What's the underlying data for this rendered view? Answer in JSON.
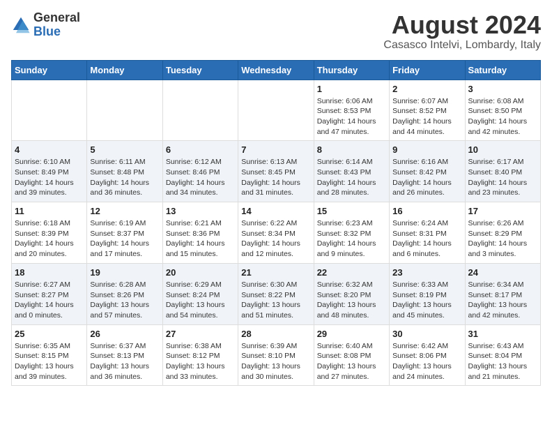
{
  "header": {
    "logo_general": "General",
    "logo_blue": "Blue",
    "month_title": "August 2024",
    "location": "Casasco Intelvi, Lombardy, Italy"
  },
  "days_of_week": [
    "Sunday",
    "Monday",
    "Tuesday",
    "Wednesday",
    "Thursday",
    "Friday",
    "Saturday"
  ],
  "weeks": [
    [
      {
        "num": "",
        "info": ""
      },
      {
        "num": "",
        "info": ""
      },
      {
        "num": "",
        "info": ""
      },
      {
        "num": "",
        "info": ""
      },
      {
        "num": "1",
        "info": "Sunrise: 6:06 AM\nSunset: 8:53 PM\nDaylight: 14 hours\nand 47 minutes."
      },
      {
        "num": "2",
        "info": "Sunrise: 6:07 AM\nSunset: 8:52 PM\nDaylight: 14 hours\nand 44 minutes."
      },
      {
        "num": "3",
        "info": "Sunrise: 6:08 AM\nSunset: 8:50 PM\nDaylight: 14 hours\nand 42 minutes."
      }
    ],
    [
      {
        "num": "4",
        "info": "Sunrise: 6:10 AM\nSunset: 8:49 PM\nDaylight: 14 hours\nand 39 minutes."
      },
      {
        "num": "5",
        "info": "Sunrise: 6:11 AM\nSunset: 8:48 PM\nDaylight: 14 hours\nand 36 minutes."
      },
      {
        "num": "6",
        "info": "Sunrise: 6:12 AM\nSunset: 8:46 PM\nDaylight: 14 hours\nand 34 minutes."
      },
      {
        "num": "7",
        "info": "Sunrise: 6:13 AM\nSunset: 8:45 PM\nDaylight: 14 hours\nand 31 minutes."
      },
      {
        "num": "8",
        "info": "Sunrise: 6:14 AM\nSunset: 8:43 PM\nDaylight: 14 hours\nand 28 minutes."
      },
      {
        "num": "9",
        "info": "Sunrise: 6:16 AM\nSunset: 8:42 PM\nDaylight: 14 hours\nand 26 minutes."
      },
      {
        "num": "10",
        "info": "Sunrise: 6:17 AM\nSunset: 8:40 PM\nDaylight: 14 hours\nand 23 minutes."
      }
    ],
    [
      {
        "num": "11",
        "info": "Sunrise: 6:18 AM\nSunset: 8:39 PM\nDaylight: 14 hours\nand 20 minutes."
      },
      {
        "num": "12",
        "info": "Sunrise: 6:19 AM\nSunset: 8:37 PM\nDaylight: 14 hours\nand 17 minutes."
      },
      {
        "num": "13",
        "info": "Sunrise: 6:21 AM\nSunset: 8:36 PM\nDaylight: 14 hours\nand 15 minutes."
      },
      {
        "num": "14",
        "info": "Sunrise: 6:22 AM\nSunset: 8:34 PM\nDaylight: 14 hours\nand 12 minutes."
      },
      {
        "num": "15",
        "info": "Sunrise: 6:23 AM\nSunset: 8:32 PM\nDaylight: 14 hours\nand 9 minutes."
      },
      {
        "num": "16",
        "info": "Sunrise: 6:24 AM\nSunset: 8:31 PM\nDaylight: 14 hours\nand 6 minutes."
      },
      {
        "num": "17",
        "info": "Sunrise: 6:26 AM\nSunset: 8:29 PM\nDaylight: 14 hours\nand 3 minutes."
      }
    ],
    [
      {
        "num": "18",
        "info": "Sunrise: 6:27 AM\nSunset: 8:27 PM\nDaylight: 14 hours\nand 0 minutes."
      },
      {
        "num": "19",
        "info": "Sunrise: 6:28 AM\nSunset: 8:26 PM\nDaylight: 13 hours\nand 57 minutes."
      },
      {
        "num": "20",
        "info": "Sunrise: 6:29 AM\nSunset: 8:24 PM\nDaylight: 13 hours\nand 54 minutes."
      },
      {
        "num": "21",
        "info": "Sunrise: 6:30 AM\nSunset: 8:22 PM\nDaylight: 13 hours\nand 51 minutes."
      },
      {
        "num": "22",
        "info": "Sunrise: 6:32 AM\nSunset: 8:20 PM\nDaylight: 13 hours\nand 48 minutes."
      },
      {
        "num": "23",
        "info": "Sunrise: 6:33 AM\nSunset: 8:19 PM\nDaylight: 13 hours\nand 45 minutes."
      },
      {
        "num": "24",
        "info": "Sunrise: 6:34 AM\nSunset: 8:17 PM\nDaylight: 13 hours\nand 42 minutes."
      }
    ],
    [
      {
        "num": "25",
        "info": "Sunrise: 6:35 AM\nSunset: 8:15 PM\nDaylight: 13 hours\nand 39 minutes."
      },
      {
        "num": "26",
        "info": "Sunrise: 6:37 AM\nSunset: 8:13 PM\nDaylight: 13 hours\nand 36 minutes."
      },
      {
        "num": "27",
        "info": "Sunrise: 6:38 AM\nSunset: 8:12 PM\nDaylight: 13 hours\nand 33 minutes."
      },
      {
        "num": "28",
        "info": "Sunrise: 6:39 AM\nSunset: 8:10 PM\nDaylight: 13 hours\nand 30 minutes."
      },
      {
        "num": "29",
        "info": "Sunrise: 6:40 AM\nSunset: 8:08 PM\nDaylight: 13 hours\nand 27 minutes."
      },
      {
        "num": "30",
        "info": "Sunrise: 6:42 AM\nSunset: 8:06 PM\nDaylight: 13 hours\nand 24 minutes."
      },
      {
        "num": "31",
        "info": "Sunrise: 6:43 AM\nSunset: 8:04 PM\nDaylight: 13 hours\nand 21 minutes."
      }
    ]
  ]
}
